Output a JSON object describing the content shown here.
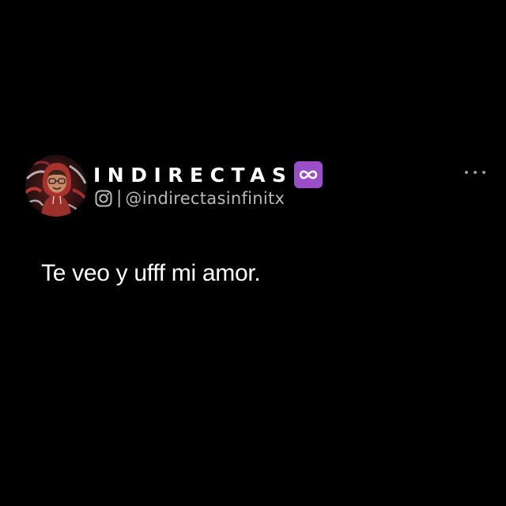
{
  "post": {
    "author_name": "INDIRECTAS",
    "name_badge_icon": "infinity-icon",
    "badge_color": "#9b4fc7",
    "handle_platform_icon": "instagram-icon",
    "separator": "|",
    "handle": "@indirectasinfinitx",
    "text": "Te veo y ufff mi amor.",
    "menu_icon": "more-horizontal-icon"
  },
  "colors": {
    "background": "#000000",
    "primary_text": "#ffffff",
    "secondary_text": "#b8b8b8"
  }
}
